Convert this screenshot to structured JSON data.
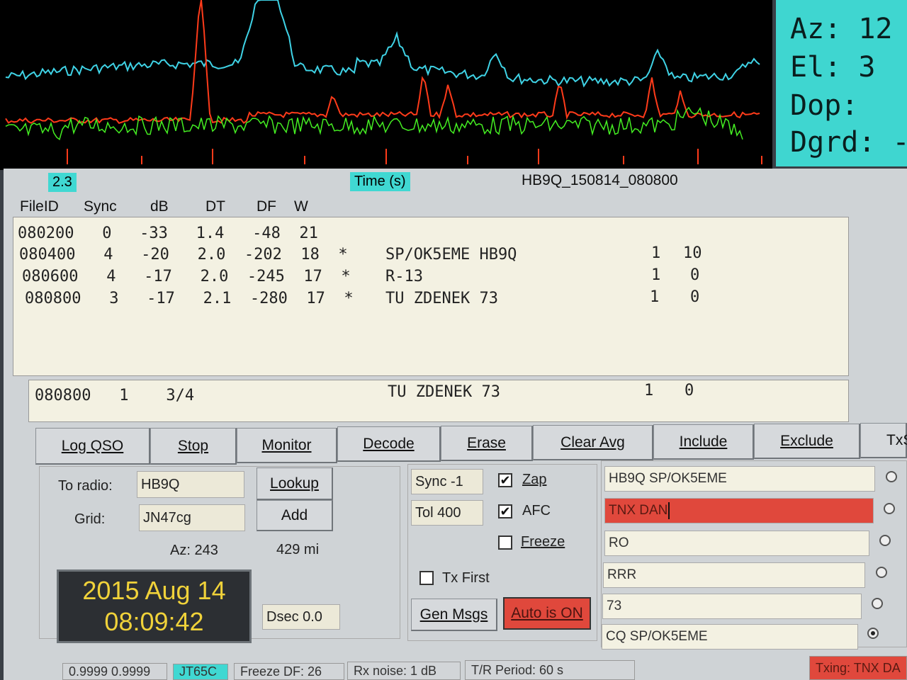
{
  "astro": {
    "az": "Az: 12",
    "el": "El:  3",
    "dop": "Dop:",
    "dgrd": "Dgrd: -"
  },
  "header": {
    "scale_value": "2.3",
    "time_label": "Time (s)",
    "file_name": "HB9Q_150814_080800"
  },
  "columns": [
    "FileID",
    "Sync",
    "dB",
    "DT",
    "DF",
    "W"
  ],
  "decodes": [
    {
      "text": "080200   0   -33   1.4   -48  21",
      "msg": "",
      "n1": "",
      "n2": ""
    },
    {
      "text": "080400   4   -20   2.0  -202  18  *",
      "msg": "SP/OK5EME HB9Q",
      "n1": "1",
      "n2": "10"
    },
    {
      "text": "080600   4   -17   2.0  -245  17  *",
      "msg": "R-13",
      "n1": "1",
      "n2": "0"
    },
    {
      "text": "080800   3   -17   2.1  -280  17  *",
      "msg": "TU ZDENEK 73",
      "n1": "1",
      "n2": "0"
    }
  ],
  "average": {
    "text": "080800   1    3/4",
    "msg": "TU ZDENEK 73",
    "n1": "1",
    "n2": "0"
  },
  "buttons": {
    "log_qso": "Log QSO",
    "stop": "Stop",
    "monitor": "Monitor",
    "decode": "Decode",
    "erase": "Erase",
    "clear_avg": "Clear Avg",
    "include": "Include",
    "exclude": "Exclude",
    "tx": "TxS"
  },
  "station": {
    "to_radio_label": "To radio:",
    "to_radio_value": "HB9Q",
    "grid_label": "Grid:",
    "grid_value": "JN47cg",
    "lookup": "Lookup",
    "add": "Add",
    "az": "Az: 243",
    "distance": "429 mi"
  },
  "clock": {
    "date": "2015 Aug 14",
    "time": "08:09:42"
  },
  "dsec": "Dsec  0.0",
  "controls": {
    "sync": "Sync   -1",
    "tol": "Tol    400",
    "zap": "Zap",
    "afc": "AFC",
    "freeze": "Freeze",
    "zap_checked": true,
    "afc_checked": true,
    "freeze_checked": false,
    "tx_first": "Tx First",
    "tx_first_checked": false,
    "gen_msgs": "Gen Msgs",
    "auto": "Auto is  ON"
  },
  "messages": [
    {
      "text": "HB9Q SP/OK5EME",
      "active": false,
      "selected": false
    },
    {
      "text": "TNX DAN",
      "active": true,
      "selected": false
    },
    {
      "text": "RO",
      "active": false,
      "selected": false
    },
    {
      "text": "RRR",
      "active": false,
      "selected": false
    },
    {
      "text": "73",
      "active": false,
      "selected": false
    },
    {
      "text": "CQ SP/OK5EME",
      "active": false,
      "selected": true
    }
  ],
  "status_bar": {
    "levels": "0.9999  0.9999",
    "mode": "JT65C",
    "freeze_df": "Freeze DF:  26",
    "rx_noise": "Rx noise:  1 dB",
    "tr_period": "T/R Period: 60 s",
    "txing": "Txing:  TNX DA"
  },
  "colors": {
    "cyan_trace": "#3fd3e6",
    "red_trace": "#ff3b1a",
    "green_trace": "#44ee22",
    "accent_red": "#e0483c"
  }
}
